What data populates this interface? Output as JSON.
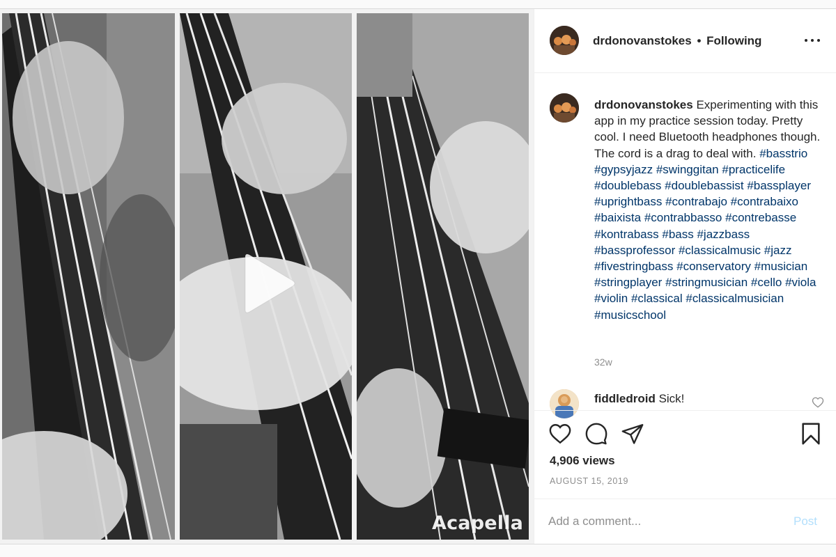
{
  "post": {
    "username": "drdonovanstokes",
    "separator": "•",
    "follow_status": "Following",
    "caption_text": "Experimenting with this app in my practice session today. Pretty cool. I need Bluetooth headphones though. The cord is a drag to deal with.",
    "hashtags": [
      "#basstrio",
      "#gypsyjazz",
      "#swinggitan",
      "#practicelife",
      "#doublebass",
      "#doublebassist",
      "#bassplayer",
      "#uprightbass",
      "#contrabajo",
      "#contrabaixo",
      "#baixista",
      "#contrabbasso",
      "#contrebasse",
      "#kontrabass",
      "#bass",
      "#jazzbass",
      "#bassprofessor",
      "#classicalmusic",
      "#jazz",
      "#fivestringbass",
      "#conservatory",
      "#musician",
      "#stringplayer",
      "#stringmusician",
      "#cello",
      "#viola",
      "#violin",
      "#classical",
      "#classicalmusician",
      "#musicschool"
    ],
    "caption_age": "32w",
    "views": "4,906 views",
    "date": "AUGUST 15, 2019"
  },
  "media": {
    "watermark": "Acapella",
    "play_icon": "play-icon"
  },
  "comments": [
    {
      "username": "fiddledroid",
      "text": "Sick!"
    }
  ],
  "comment_box": {
    "placeholder": "Add a comment...",
    "post_label": "Post"
  },
  "icons": {
    "like": "heart-icon",
    "comment": "comment-bubble-icon",
    "share": "paper-plane-icon",
    "save": "bookmark-icon",
    "more": "more-dots-icon",
    "comment_like": "small-heart-icon"
  },
  "colors": {
    "hashtag": "#003569",
    "muted_text": "#8e8e8e",
    "post_button_disabled": "#b2dffc"
  }
}
